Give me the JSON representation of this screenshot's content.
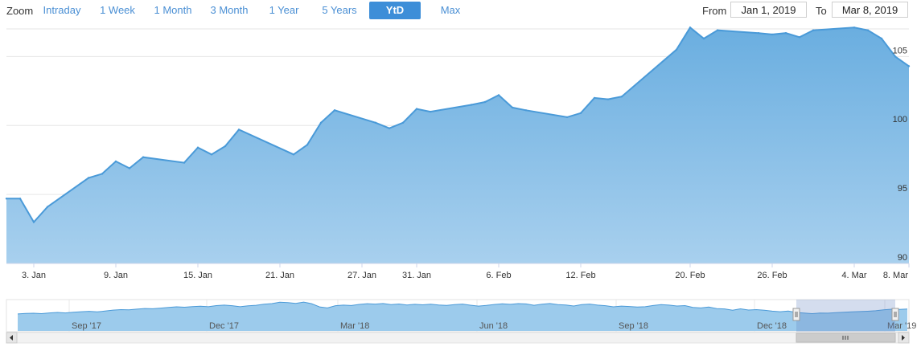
{
  "toolbar": {
    "zoom_label": "Zoom",
    "buttons": [
      {
        "label": "Intraday",
        "active": false
      },
      {
        "label": "1 Week",
        "active": false
      },
      {
        "label": "1 Month",
        "active": false
      },
      {
        "label": "3 Month",
        "active": false
      },
      {
        "label": "1 Year",
        "active": false
      },
      {
        "label": "5 Years",
        "active": false
      },
      {
        "label": "YtD",
        "active": true
      },
      {
        "label": "Max",
        "active": false
      }
    ],
    "from_label": "From",
    "from_value": "Jan 1, 2019",
    "to_label": "To",
    "to_value": "Mar 8, 2019"
  },
  "colors": {
    "accent": "#3d8ed8",
    "series_line": "#4a9ad8",
    "area_top": "#6aaee0",
    "area_bottom": "#a8d0ee"
  },
  "chart_data": {
    "type": "area",
    "title": "",
    "xlabel": "",
    "ylabel": "",
    "ylim": [
      90,
      107
    ],
    "grid": true,
    "x_tick_labels": [
      "3. Jan",
      "9. Jan",
      "15. Jan",
      "21. Jan",
      "27. Jan",
      "31. Jan",
      "6. Feb",
      "12. Feb",
      "20. Feb",
      "26. Feb",
      "4. Mar",
      "8. Mar"
    ],
    "y_tick_labels": [
      "90",
      "95",
      "100",
      "105"
    ],
    "series": [
      {
        "x": [
          "2019-01-01",
          "2019-01-02",
          "2019-01-03",
          "2019-01-04",
          "2019-01-07",
          "2019-01-08",
          "2019-01-09",
          "2019-01-10",
          "2019-01-11",
          "2019-01-14",
          "2019-01-15",
          "2019-01-16",
          "2019-01-17",
          "2019-01-18",
          "2019-01-22",
          "2019-01-23",
          "2019-01-24",
          "2019-01-25",
          "2019-01-28",
          "2019-01-29",
          "2019-01-30",
          "2019-01-31",
          "2019-02-01",
          "2019-02-04",
          "2019-02-05",
          "2019-02-06",
          "2019-02-07",
          "2019-02-08",
          "2019-02-11",
          "2019-02-12",
          "2019-02-13",
          "2019-02-14",
          "2019-02-15",
          "2019-02-19",
          "2019-02-20",
          "2019-02-21",
          "2019-02-22",
          "2019-02-25",
          "2019-02-26",
          "2019-02-27",
          "2019-02-28",
          "2019-03-01",
          "2019-03-04",
          "2019-03-05",
          "2019-03-06",
          "2019-03-07",
          "2019-03-08"
        ],
        "values": [
          94.7,
          94.7,
          93.0,
          94.1,
          96.2,
          96.5,
          97.4,
          96.9,
          97.7,
          97.3,
          98.4,
          97.9,
          98.5,
          99.7,
          97.9,
          98.6,
          100.2,
          101.1,
          100.2,
          99.8,
          100.2,
          101.2,
          101.0,
          101.5,
          101.7,
          102.2,
          101.3,
          101.1,
          100.6,
          100.9,
          102.0,
          101.9,
          102.1,
          105.5,
          107.1,
          106.3,
          106.9,
          106.7,
          106.6,
          106.7,
          106.4,
          106.9,
          107.1,
          106.9,
          106.3,
          105.0,
          104.3
        ]
      }
    ],
    "navigator": {
      "x_tick_labels": [
        "Sep '17",
        "Dec '17",
        "Mar '18",
        "Jun '18",
        "Sep '18",
        "Dec '18",
        "Mar '19"
      ],
      "values": [
        100,
        100.5,
        100.8,
        100.3,
        101.2,
        101.8,
        101.2,
        102.0,
        102.6,
        103.1,
        102.4,
        103.4,
        104.5,
        105.1,
        104.8,
        105.6,
        106.4,
        106.1,
        106.9,
        107.6,
        108.4,
        107.9,
        108.7,
        109.1,
        108.5,
        109.8,
        110.4,
        109.7,
        108.5,
        109.6,
        110.2,
        111.5,
        112.2,
        113.9,
        113.3,
        112.4,
        114.0,
        112.1,
        108.3,
        107.1,
        109.7,
        110.4,
        109.9,
        111.2,
        112.1,
        111.6,
        112.3,
        111.0,
        111.7,
        110.6,
        111.3,
        110.7,
        111.4,
        110.6,
        110.1,
        110.9,
        111.6,
        110.3,
        109.2,
        110.0,
        111.1,
        111.9,
        111.3,
        112.2,
        111.8,
        110.2,
        111.5,
        112.3,
        111.0,
        110.6,
        109.3,
        110.9,
        111.6,
        110.4,
        109.7,
        108.4,
        109.2,
        108.8,
        108.2,
        108.5,
        109.9,
        111.0,
        110.4,
        109.3,
        109.8,
        107.7,
        107.1,
        108.2,
        106.3,
        105.9,
        104.3,
        106.0,
        104.6,
        105.1,
        104.4,
        103.3,
        102.6,
        103.4,
        101.8,
        101.1,
        100.3,
        101.0,
        100.9,
        101.5,
        101.9,
        102.4,
        102.8,
        103.2,
        103.7,
        104.9,
        105.5,
        105.3,
        105.8
      ]
    }
  }
}
